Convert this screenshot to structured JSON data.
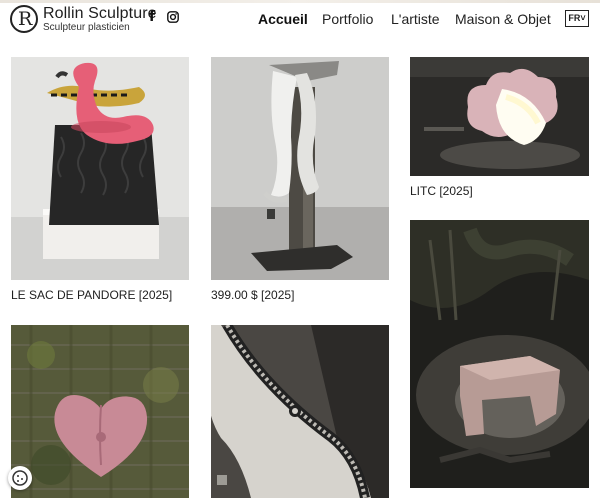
{
  "header": {
    "brand_name": "Rollin Sculpture",
    "brand_subtitle": "Sculpteur plasticien",
    "logo_letter": "R",
    "social": [
      {
        "icon": "facebook-icon",
        "glyph": "f"
      },
      {
        "icon": "instagram-icon"
      }
    ],
    "nav": [
      {
        "label": "Accueil",
        "active": true
      },
      {
        "label": "Portfolio",
        "active": false
      },
      {
        "label": "L'artiste",
        "active": false
      },
      {
        "label": "Maison & Objet",
        "active": false
      }
    ],
    "language": "FR"
  },
  "gallery": {
    "items": [
      {
        "caption": "LE SAC DE PANDORE [2025]",
        "image": "pink-flamingo-bag-sculpture"
      },
      {
        "caption": "399.00 $ [2025]",
        "image": "legs-on-pillar-sculpture"
      },
      {
        "caption": "LITC [2025]",
        "image": "cloud-lamp-sculpture"
      },
      {
        "caption": "",
        "image": "stone-bench-sculpture"
      },
      {
        "caption": "",
        "image": "pink-heart-cushion-sculpture"
      },
      {
        "caption": "",
        "image": "zipper-sculpture"
      }
    ]
  },
  "cookie_icon": "cookie-icon",
  "colors": {
    "text": "#1e1e1e",
    "pink": "#e65f77",
    "lamp_pink": "#d9b3b8",
    "background": "#ffffff"
  }
}
